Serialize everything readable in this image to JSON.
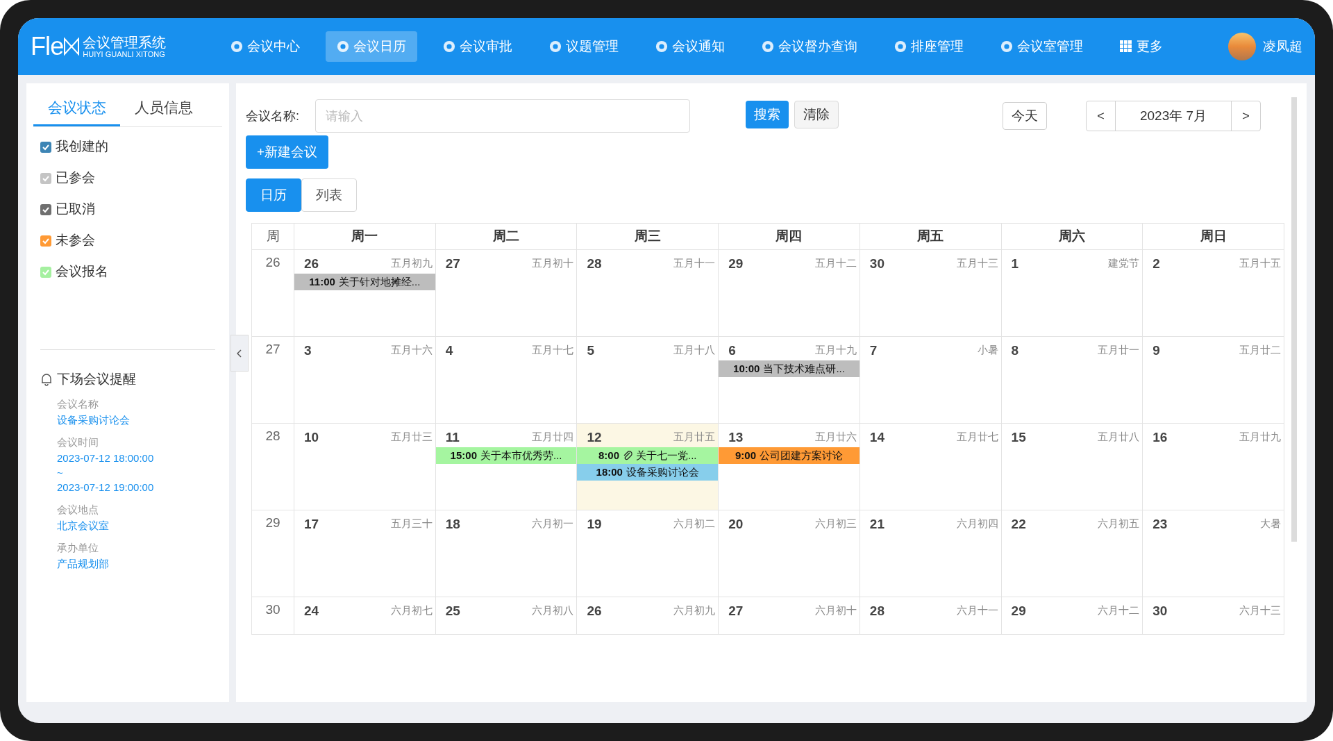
{
  "header": {
    "logo": {
      "wordmark": "Fle",
      "title": "会议管理系统",
      "subtitle": "HUIYI GUANLI XITONG"
    },
    "nav": [
      {
        "label": "会议中心",
        "kind": "module",
        "selected": false
      },
      {
        "label": "会议日历",
        "kind": "module",
        "selected": true
      },
      {
        "label": "会议审批",
        "kind": "module",
        "selected": false
      },
      {
        "label": "议题管理",
        "kind": "module",
        "selected": false
      },
      {
        "label": "会议通知",
        "kind": "module",
        "selected": false
      },
      {
        "label": "会议督办查询",
        "kind": "module",
        "selected": false
      },
      {
        "label": "排座管理",
        "kind": "module",
        "selected": false
      },
      {
        "label": "会议室管理",
        "kind": "module",
        "selected": false
      },
      {
        "label": "更多",
        "kind": "more",
        "selected": false
      }
    ],
    "user": {
      "name": "凌凤超"
    }
  },
  "sidebar": {
    "tabs": [
      {
        "label": "会议状态",
        "selected": true
      },
      {
        "label": "人员信息",
        "selected": false
      }
    ],
    "statuses": [
      {
        "label": "我创建的",
        "checked": true,
        "color": "#3d85b5"
      },
      {
        "label": "已参会",
        "checked": true,
        "color": "#c4c4c4"
      },
      {
        "label": "已取消",
        "checked": true,
        "color": "#6f6f6f"
      },
      {
        "label": "未参会",
        "checked": true,
        "color": "#ff9a35"
      },
      {
        "label": "会议报名",
        "checked": true,
        "color": "#a5f0a0"
      }
    ],
    "reminder": {
      "title": "下场会议提醒",
      "fields": [
        {
          "label": "会议名称",
          "lines": [
            "设备采购讨论会"
          ]
        },
        {
          "label": "会议时间",
          "lines": [
            "2023-07-12 18:00:00",
            "~",
            "2023-07-12 19:00:00"
          ]
        },
        {
          "label": "会议地点",
          "lines": [
            "北京会议室"
          ]
        },
        {
          "label": "承办单位",
          "lines": [
            "产品规划部"
          ]
        }
      ]
    }
  },
  "toolbar": {
    "name_label": "会议名称:",
    "name_placeholder": "请输入",
    "search": "搜索",
    "clear": "清除",
    "today": "今天",
    "prev": "<",
    "month": "2023年 7月",
    "next": ">",
    "new_meeting": "+新建会议",
    "views": [
      {
        "label": "日历",
        "selected": true
      },
      {
        "label": "列表",
        "selected": false
      }
    ]
  },
  "calendar": {
    "week_header": "周",
    "weekdays": [
      "周一",
      "周二",
      "周三",
      "周四",
      "周五",
      "周六",
      "周日"
    ],
    "weeks": [
      {
        "number": "26",
        "days": [
          {
            "day": "26",
            "lunar": "五月初九",
            "today": false,
            "events": [
              {
                "time": "11:00",
                "title": "关于针对地摊经...",
                "color": "#bdbdbd",
                "attachment": false
              }
            ]
          },
          {
            "day": "27",
            "lunar": "五月初十",
            "today": false
          },
          {
            "day": "28",
            "lunar": "五月十一",
            "today": false
          },
          {
            "day": "29",
            "lunar": "五月十二",
            "today": false
          },
          {
            "day": "30",
            "lunar": "五月十三",
            "today": false
          },
          {
            "day": "1",
            "lunar": "建党节",
            "today": false
          },
          {
            "day": "2",
            "lunar": "五月十五",
            "today": false
          }
        ]
      },
      {
        "number": "27",
        "days": [
          {
            "day": "3",
            "lunar": "五月十六",
            "today": false
          },
          {
            "day": "4",
            "lunar": "五月十七",
            "today": false
          },
          {
            "day": "5",
            "lunar": "五月十八",
            "today": false
          },
          {
            "day": "6",
            "lunar": "五月十九",
            "today": false,
            "events": [
              {
                "time": "10:00",
                "title": "当下技术难点研...",
                "color": "#bdbdbd",
                "attachment": false
              }
            ]
          },
          {
            "day": "7",
            "lunar": "小暑",
            "today": false
          },
          {
            "day": "8",
            "lunar": "五月廿一",
            "today": false
          },
          {
            "day": "9",
            "lunar": "五月廿二",
            "today": false
          }
        ]
      },
      {
        "number": "28",
        "days": [
          {
            "day": "10",
            "lunar": "五月廿三",
            "today": false
          },
          {
            "day": "11",
            "lunar": "五月廿四",
            "today": false,
            "events": [
              {
                "time": "15:00",
                "title": "关于本市优秀劳...",
                "color": "#a5f5a0",
                "attachment": false
              }
            ]
          },
          {
            "day": "12",
            "lunar": "五月廿五",
            "today": true,
            "events": [
              {
                "time": "8:00",
                "title": "关于七一党...",
                "color": "#a5f5a0",
                "attachment": true
              },
              {
                "time": "18:00",
                "title": "设备采购讨论会",
                "color": "#87ceeb",
                "attachment": false
              }
            ]
          },
          {
            "day": "13",
            "lunar": "五月廿六",
            "today": false,
            "events": [
              {
                "time": "9:00",
                "title": "公司团建方案讨论",
                "color": "#ff9a35",
                "attachment": false
              }
            ]
          },
          {
            "day": "14",
            "lunar": "五月廿七",
            "today": false
          },
          {
            "day": "15",
            "lunar": "五月廿八",
            "today": false
          },
          {
            "day": "16",
            "lunar": "五月廿九",
            "today": false
          }
        ]
      },
      {
        "number": "29",
        "days": [
          {
            "day": "17",
            "lunar": "五月三十",
            "today": false
          },
          {
            "day": "18",
            "lunar": "六月初一",
            "today": false
          },
          {
            "day": "19",
            "lunar": "六月初二",
            "today": false
          },
          {
            "day": "20",
            "lunar": "六月初三",
            "today": false
          },
          {
            "day": "21",
            "lunar": "六月初四",
            "today": false
          },
          {
            "day": "22",
            "lunar": "六月初五",
            "today": false
          },
          {
            "day": "23",
            "lunar": "大暑",
            "today": false
          }
        ]
      },
      {
        "number": "30",
        "days": [
          {
            "day": "24",
            "lunar": "六月初七",
            "today": false
          },
          {
            "day": "25",
            "lunar": "六月初八",
            "today": false
          },
          {
            "day": "26",
            "lunar": "六月初九",
            "today": false
          },
          {
            "day": "27",
            "lunar": "六月初十",
            "today": false
          },
          {
            "day": "28",
            "lunar": "六月十一",
            "today": false
          },
          {
            "day": "29",
            "lunar": "六月十二",
            "today": false
          },
          {
            "day": "30",
            "lunar": "六月十三",
            "today": false
          }
        ]
      }
    ]
  }
}
